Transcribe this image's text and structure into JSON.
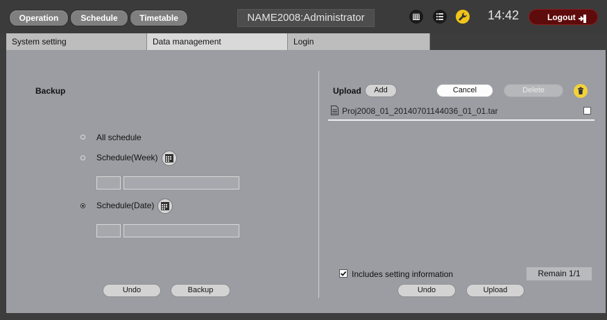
{
  "nav": {
    "operation": "Operation",
    "schedule": "Schedule",
    "timetable": "Timetable"
  },
  "header": {
    "title": "NAME2008:Administrator",
    "clock": "14:42",
    "logout": "Logout"
  },
  "icons": {
    "calendar": "calendar-icon",
    "list": "list-icon",
    "wrench": "wrench-icon",
    "logout": "logout-icon",
    "trash": "trash-icon",
    "file": "file-icon"
  },
  "colors": {
    "logout_bg": "#5e0b0b",
    "wrench": "#f0c419",
    "trash": "#f2d23b"
  },
  "tabs": [
    {
      "label": "System setting"
    },
    {
      "label": "Data management"
    },
    {
      "label": "Login"
    }
  ],
  "backup": {
    "title": "Backup",
    "options": [
      {
        "label": "All schedule"
      },
      {
        "label": "Schedule(Week)"
      },
      {
        "label": "Schedule(Date)"
      }
    ],
    "selected": "Schedule(Date)",
    "undo": "Undo",
    "backup": "Backup"
  },
  "upload": {
    "title": "Upload",
    "add": "Add",
    "cancel": "Cancel",
    "delete": "Delete",
    "files": [
      {
        "name": "Proj2008_01_20140701144036_01_01.tar"
      }
    ],
    "includes": "Includes setting information",
    "remain": "Remain 1/1",
    "undo": "Undo",
    "upload": "Upload"
  }
}
